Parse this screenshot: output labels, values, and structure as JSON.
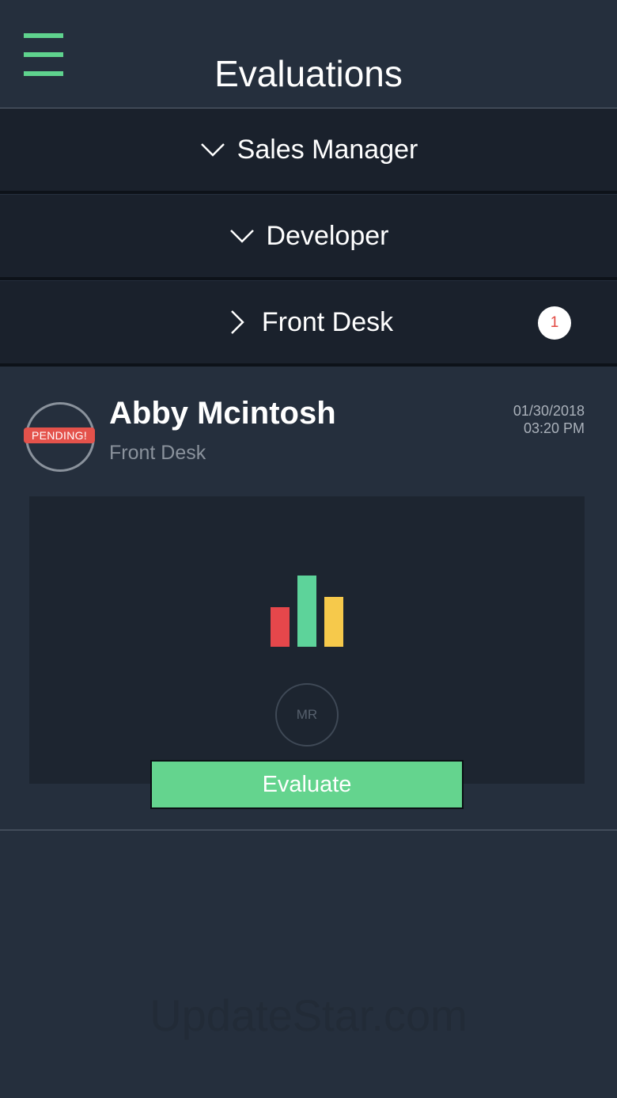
{
  "header": {
    "title": "Evaluations"
  },
  "groups": [
    {
      "label": "Sales Manager",
      "state": "expanded"
    },
    {
      "label": "Developer",
      "state": "expanded"
    },
    {
      "label": "Front Desk",
      "state": "collapsed",
      "badge": "1"
    }
  ],
  "evaluation": {
    "status": "PENDING!",
    "name": "Abby Mcintosh",
    "role": "Front Desk",
    "date": "01/30/2018",
    "time": "03:20 PM",
    "initials": "MR",
    "evaluate_label": "Evaluate",
    "chart_icon": {
      "bars": [
        {
          "color": "#e5474b",
          "level": 0.55
        },
        {
          "color": "#5dd39a",
          "level": 1.0
        },
        {
          "color": "#f6c94b",
          "level": 0.7
        }
      ]
    }
  },
  "watermark": "UpdateStar.com",
  "colors": {
    "accent": "#5fd38e",
    "pending": "#e4524b",
    "background": "#252f3d"
  }
}
